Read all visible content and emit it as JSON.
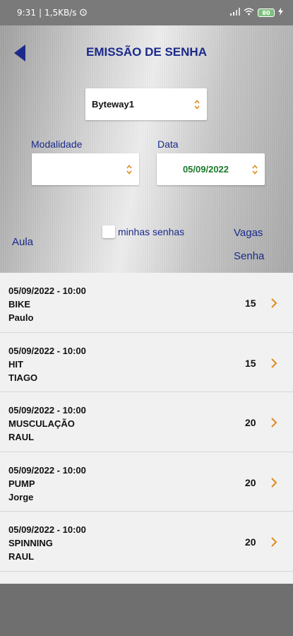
{
  "status": {
    "time": "9:31",
    "speed": "1,5KB/s",
    "battery": "80"
  },
  "header": {
    "title": "EMISSÃO DE SENHA"
  },
  "filters": {
    "company": "Byteway1",
    "modalidade_label": "Modalidade",
    "modalidade_value": "",
    "data_label": "Data",
    "data_value": "05/09/2022"
  },
  "columns": {
    "aula": "Aula",
    "minhas_senhas": "minhas senhas",
    "vagas": "Vagas",
    "senha": "Senha"
  },
  "classes": [
    {
      "datetime": "05/09/2022 - 10:00",
      "name": "BIKE",
      "instructor": "Paulo",
      "vagas": "15"
    },
    {
      "datetime": "05/09/2022 - 10:00",
      "name": "HIT",
      "instructor": "TIAGO",
      "vagas": "15"
    },
    {
      "datetime": "05/09/2022 - 10:00",
      "name": "MUSCULAÇÃO",
      "instructor": "RAUL",
      "vagas": "20"
    },
    {
      "datetime": "05/09/2022 - 10:00",
      "name": "PUMP",
      "instructor": "Jorge",
      "vagas": "20"
    },
    {
      "datetime": "05/09/2022 - 10:00",
      "name": "SPINNING",
      "instructor": "RAUL",
      "vagas": "20"
    }
  ],
  "colors": {
    "accent": "#1b2a8a",
    "date_text": "#1a7a2a",
    "chevron": "#e08a1e"
  }
}
